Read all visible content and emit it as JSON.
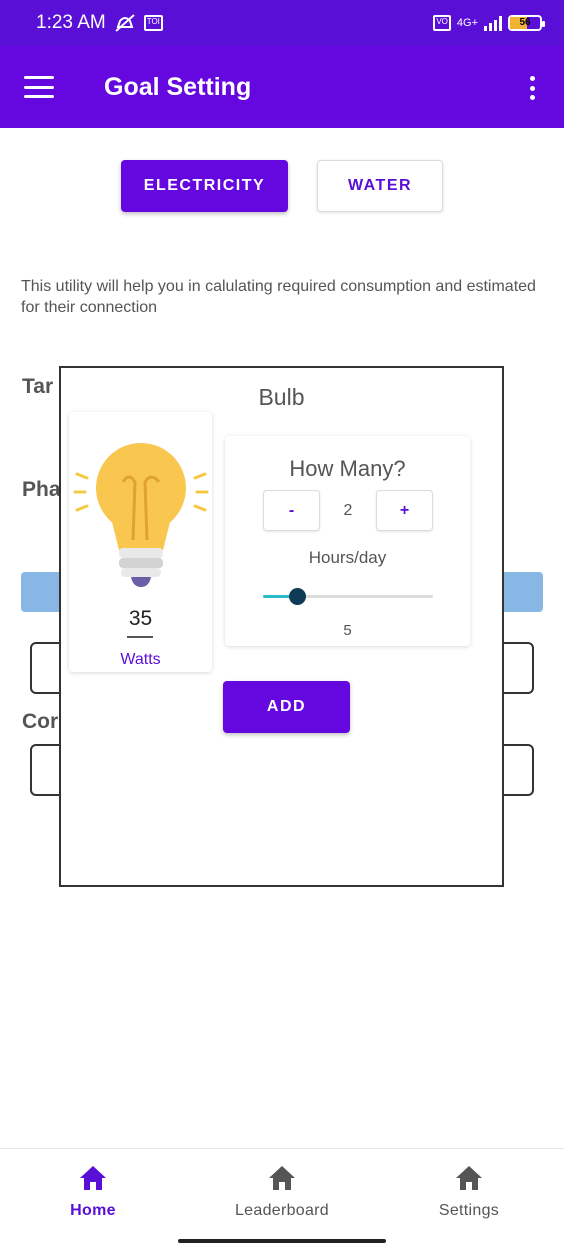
{
  "status_bar": {
    "time": "1:23 AM",
    "network": "4G+",
    "battery": "56"
  },
  "app_bar": {
    "title": "Goal Setting"
  },
  "tabs": [
    {
      "label": "ELECTRICITY",
      "selected": true
    },
    {
      "label": "WATER",
      "selected": false
    }
  ],
  "description": "This utility will help you in calulating required consumption and estimated for their connection",
  "background_labels": {
    "tariff": "Tar",
    "phase": "Pha",
    "consumption": "Cor"
  },
  "dialog": {
    "title": "Bulb",
    "appliance_icon": "light-bulb-icon",
    "watts_value": "35",
    "watts_label": "Watts",
    "quantity_title": "How Many?",
    "decrement_label": "-",
    "increment_label": "+",
    "quantity_value": "2",
    "hours_label": "Hours/day",
    "hours_value": "5",
    "hours_slider_fraction": 0.2,
    "add_label": "ADD"
  },
  "bottom_nav": {
    "items": [
      {
        "label": "Home",
        "icon": "home-icon",
        "active": true
      },
      {
        "label": "Leaderboard",
        "icon": "home-icon",
        "active": false
      },
      {
        "label": "Settings",
        "icon": "home-icon",
        "active": false
      }
    ]
  },
  "colors": {
    "primary": "#6508e0",
    "status_bar": "#5a0fd6",
    "slider_fill": "#29bcc6",
    "slider_thumb": "#0f3b57",
    "nav_active": "#5a0fd6",
    "nav_inactive": "#555555"
  }
}
